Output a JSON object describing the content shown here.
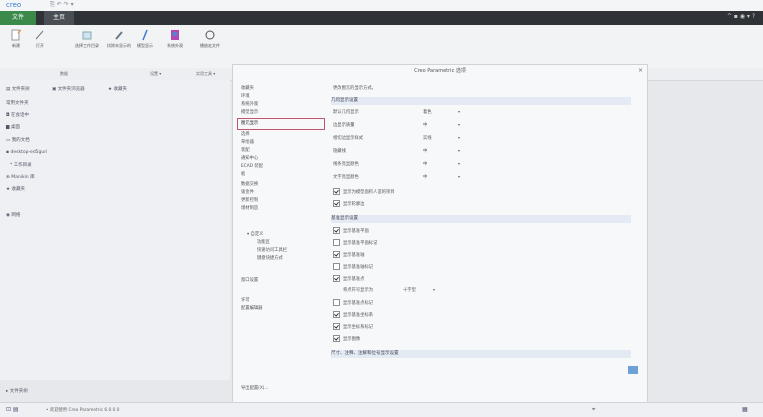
{
  "app": {
    "logo": "creo"
  },
  "tabs": {
    "file": "文件",
    "home": "主页"
  },
  "ribbon": [
    {
      "label": "新建"
    },
    {
      "label": "打开"
    },
    {
      "label": "选择工作目录"
    },
    {
      "label": "拭除未显示的"
    },
    {
      "label": "模型显示"
    },
    {
      "label": "系统外观"
    },
    {
      "label": "播放宏文件"
    }
  ],
  "groups": {
    "data": "数据",
    "settings": "设置 ▾",
    "utilities": "实用工具 ▾"
  },
  "nav": {
    "tab_folder": "文件夹树",
    "tab_browser": "文件夹浏览器",
    "tab_favorites": "收藏夹",
    "common_folders": "常用文件夹",
    "in_session": "在会话中",
    "desktop": "桌面",
    "my_docs": "我的文档",
    "desktop_path": "desktop-ed5guri",
    "working_dir": "工作目录",
    "manikin": "Manikin 库",
    "favorites": "收藏夹",
    "network": "网络",
    "folder_tree": "文件夹树"
  },
  "dialog": {
    "title": "Creo Parametric 选项",
    "close": "×",
    "categories": [
      "收藏夹",
      "环境",
      "系统外观",
      "模型显示",
      "图元显示",
      "选择",
      "草绘器",
      "装配",
      "通知中心",
      "ECAD 装配",
      "板",
      "数据交换",
      "钣金件",
      "更新控制",
      "增材制造"
    ],
    "sub_categories": [
      "自定义",
      "功能区",
      "快速访问工具栏",
      "键盘快捷方式"
    ],
    "more_categories": [
      "窗口设置"
    ],
    "more2": [
      "许可",
      "配置编辑器"
    ],
    "selected_index": 4,
    "intro": "更改图元的显示方式。",
    "section1": "几何显示设置",
    "settings": [
      {
        "label": "默认几何显示",
        "value": "着色"
      },
      {
        "label": "边显示质量",
        "value": "中"
      },
      {
        "label": "相切边显示样式",
        "value": "实线"
      },
      {
        "label": "隐藏线",
        "value": "中"
      },
      {
        "label": "线条亮显颜色",
        "value": "中"
      },
      {
        "label": "文字亮显颜色",
        "value": "中"
      }
    ],
    "section1_checks": [
      {
        "label": "显示为模型面积人造的项目",
        "on": true
      },
      {
        "label": "显示轮廓边",
        "on": true
      }
    ],
    "section2": "基准显示设置",
    "section2_checks": [
      {
        "label": "显示基准平面",
        "on": true
      },
      {
        "label": "显示基准平面标记",
        "on": false
      },
      {
        "label": "显示基准轴",
        "on": true
      },
      {
        "label": "显示基准轴标记",
        "on": false
      },
      {
        "label": "显示基准点",
        "on": true
      }
    ],
    "point_symbol_label": "将点符号显示为",
    "point_symbol_value": "十字型",
    "section2_more": [
      {
        "label": "显示基准点标记",
        "on": false
      },
      {
        "label": "显示基准坐标系",
        "on": true
      },
      {
        "label": "显示坐标系标记",
        "on": true
      },
      {
        "label": "显示图像",
        "on": true
      }
    ],
    "section3": "尺寸、注释、注解和位号显示设置",
    "export_button": "导出配置(X)..."
  },
  "status": {
    "text": "• 欢迎使用 Creo Parametric 6.0.0.0"
  }
}
